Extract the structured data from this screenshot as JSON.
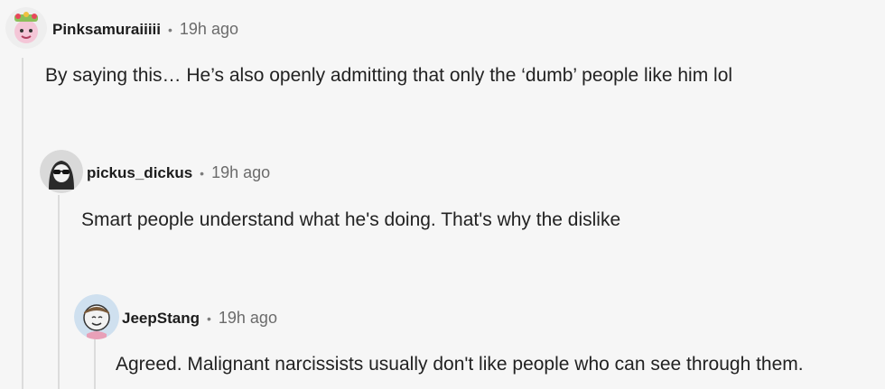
{
  "comments": [
    {
      "username": "Pinksamuraiiiii",
      "dot": "•",
      "time": "19h ago",
      "text": "By saying this… He’s also openly admitting that only the ‘dumb’ people like him lol",
      "avatar_icon": "pink-samurai-avatar-icon",
      "avatar_color": "#f4c6d7"
    },
    {
      "username": "pickus_dickus",
      "dot": "•",
      "time": "19h ago",
      "text": "Smart people understand what he's doing. That's why the dislike",
      "avatar_icon": "hooded-sunglasses-avatar-icon",
      "avatar_color": "#d9d9d9"
    },
    {
      "username": "JeepStang",
      "dot": "•",
      "time": "19h ago",
      "text": "Agreed. Malignant narcissists usually don't like people who can see through them.",
      "avatar_icon": "bandana-avatar-icon",
      "avatar_color": "#cfe0ef"
    }
  ]
}
